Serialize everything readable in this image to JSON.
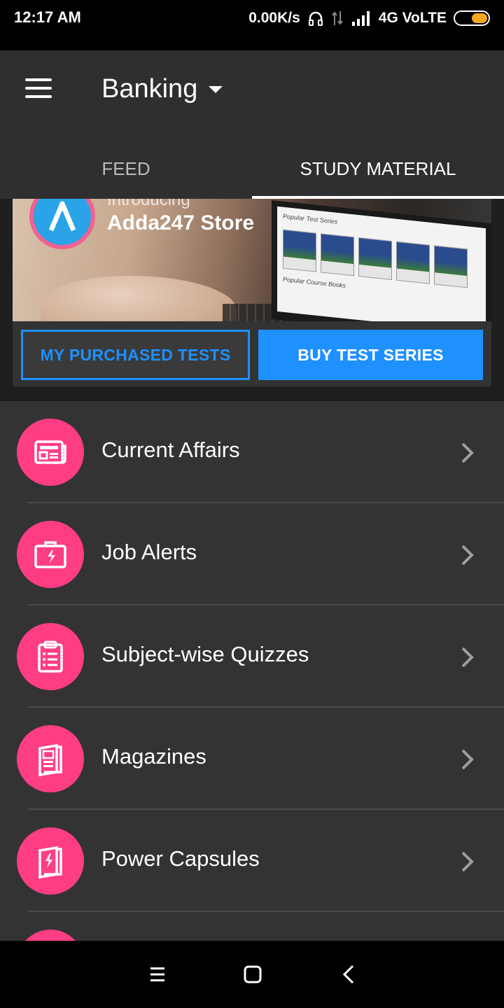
{
  "status_bar": {
    "time": "12:17 AM",
    "speed": "0.00K/s",
    "network": "4G VoLTE",
    "icons": [
      "headphones-icon",
      "data-arrows-icon",
      "signal-icon",
      "battery-icon"
    ]
  },
  "app_bar": {
    "title": "Banking",
    "menu_icon": "hamburger-icon",
    "dropdown_icon": "caret-down-icon"
  },
  "tabs": [
    {
      "label": "FEED",
      "active": false
    },
    {
      "label": "STUDY MATERIAL",
      "active": true
    }
  ],
  "banner": {
    "intro": "Introducing",
    "store_name": "Adda247 Store",
    "screen_heading": "Popular Test Series",
    "screen_footer": "Popular Course Books"
  },
  "buttons": {
    "purchased": "MY PURCHASED TESTS",
    "buy": "BUY TEST SERIES"
  },
  "list_items": [
    {
      "label": "Current Affairs",
      "icon": "newspaper-icon"
    },
    {
      "label": "Job Alerts",
      "icon": "briefcase-icon"
    },
    {
      "label": "Subject-wise Quizzes",
      "icon": "clipboard-icon"
    },
    {
      "label": "Magazines",
      "icon": "magazine-icon"
    },
    {
      "label": "Power Capsules",
      "icon": "power-capsule-icon"
    }
  ],
  "nav_bar": {
    "icons": [
      "recents-icon",
      "home-icon",
      "back-icon"
    ]
  },
  "colors": {
    "accent_pink": "#ff3d84",
    "accent_blue": "#1e90ff",
    "app_bar": "#2f2f2f",
    "list_bg": "#333333"
  }
}
